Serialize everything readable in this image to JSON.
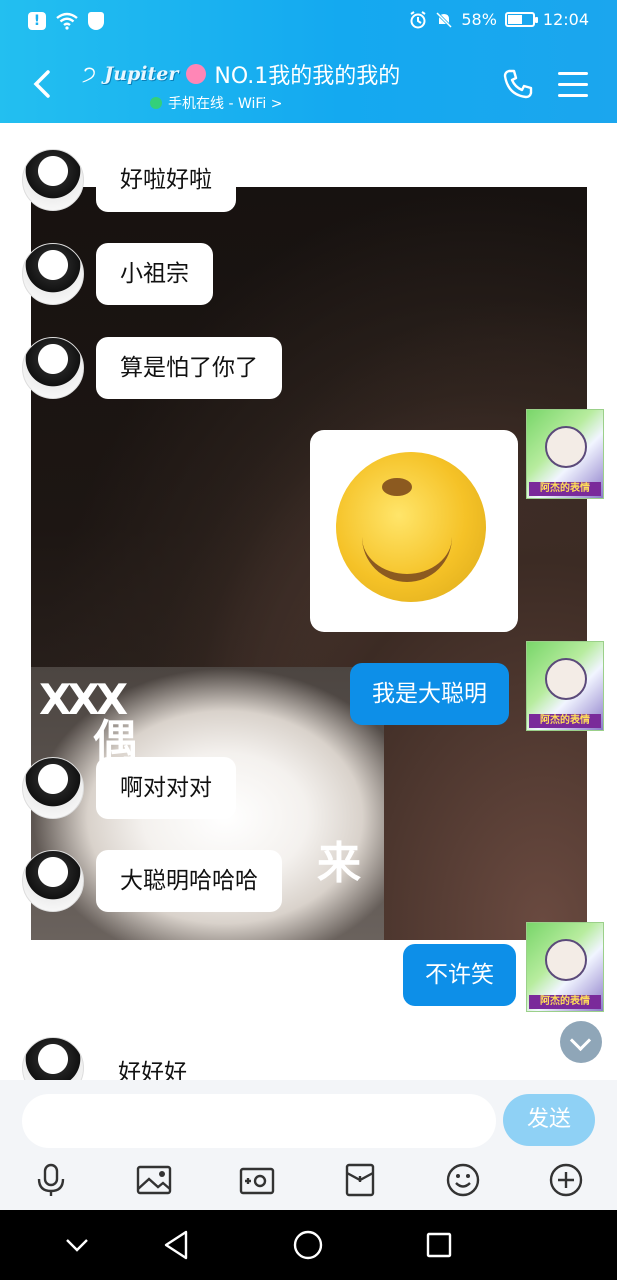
{
  "status": {
    "battery": "58%",
    "time": "12:04"
  },
  "header": {
    "badge": "Jupiter",
    "title": "NO.1我的我的我的",
    "subtitle": "手机在线 - WiFi >"
  },
  "messages": [
    {
      "side": "left",
      "text": "好啦好啦"
    },
    {
      "side": "left",
      "text": "小祖宗"
    },
    {
      "side": "left",
      "text": "算是怕了你了"
    },
    {
      "side": "right",
      "type": "sticker",
      "name": "smiley-sticker"
    },
    {
      "side": "right",
      "text": "我是大聪明"
    },
    {
      "side": "left",
      "text": "啊对对对"
    },
    {
      "side": "left",
      "text": "大聪明哈哈哈"
    },
    {
      "side": "right",
      "text": "不许笑"
    },
    {
      "side": "left",
      "text": "好好好"
    }
  ],
  "background_image": {
    "char1": "偶",
    "char2": "来",
    "mark": "XXX"
  },
  "avatar_tag": "阿杰的表情",
  "input": {
    "placeholder": "",
    "send_label": "发送"
  },
  "toolbar": [
    "mic-icon",
    "image-icon",
    "camera-icon",
    "gift-icon",
    "emoji-icon",
    "plus-icon"
  ],
  "colors": {
    "header": "#14a9f0",
    "bubble_right": "#0d8fe8",
    "send": "#8fd1f5"
  }
}
